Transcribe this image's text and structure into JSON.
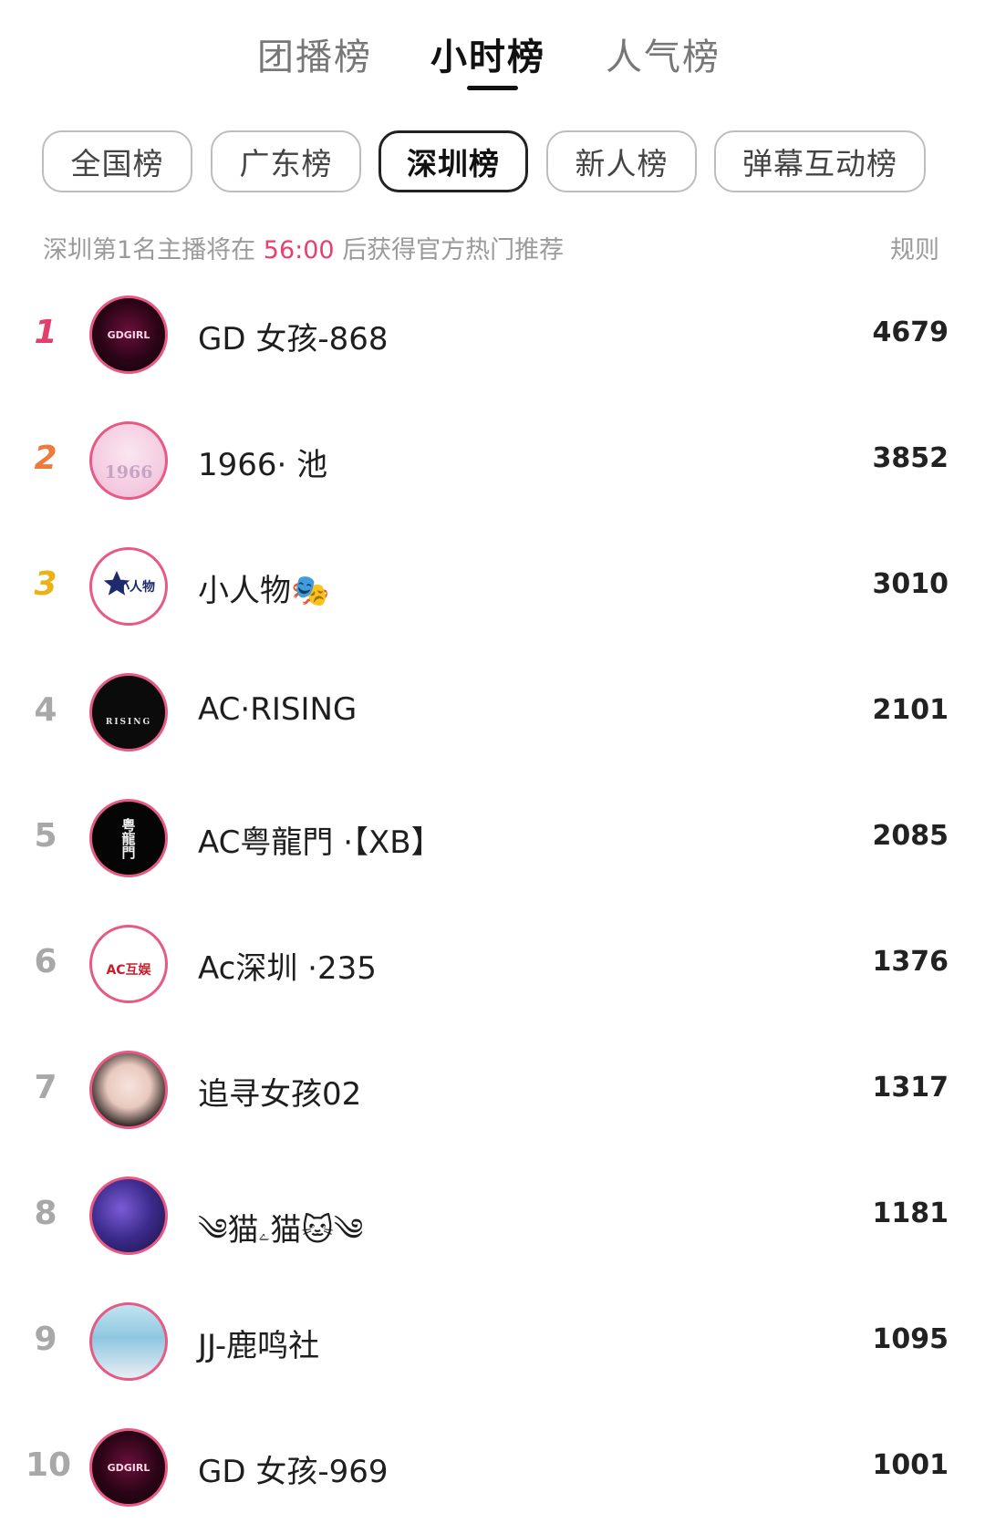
{
  "top_tabs": [
    {
      "label": "团播榜"
    },
    {
      "label": "小时榜"
    },
    {
      "label": "人气榜"
    }
  ],
  "active_top_tab": "小时榜",
  "filters": [
    {
      "label": "全国榜"
    },
    {
      "label": "广东榜"
    },
    {
      "label": "深圳榜"
    },
    {
      "label": "新人榜"
    },
    {
      "label": "弹幕互动榜"
    }
  ],
  "active_filter": "深圳榜",
  "notice": {
    "prefix": "深圳第1名主播将在",
    "countdown": "56:00",
    "suffix": "后获得官方热门推荐"
  },
  "rules_label": "规则",
  "colors": {
    "accent_pink": "#e8406e",
    "rank1": "#e2406b",
    "rank2": "#ee7a3d",
    "rank3": "#eab216"
  },
  "entries": [
    {
      "rank": "1",
      "name": "GD 女孩-868",
      "score": "4679",
      "avatar_text": "GDGIRL"
    },
    {
      "rank": "2",
      "name": "1966· 池",
      "score": "3852",
      "avatar_text": "1966"
    },
    {
      "rank": "3",
      "name": "小人物🎭",
      "score": "3010",
      "avatar_text": "小人物"
    },
    {
      "rank": "4",
      "name": "AC·RISING",
      "score": "2101",
      "avatar_text": "RISING"
    },
    {
      "rank": "5",
      "name": "AC粤龍門 ·【XB】",
      "score": "2085",
      "avatar_text": "粤龍門"
    },
    {
      "rank": "6",
      "name": "Ac深圳 ·235",
      "score": "1376",
      "avatar_text": "AC互娱"
    },
    {
      "rank": "7",
      "name": "追寻女孩02",
      "score": "1317",
      "avatar_text": ""
    },
    {
      "rank": "8",
      "name": "༄猫ۦ猫🐱༄",
      "score": "1181",
      "avatar_text": ""
    },
    {
      "rank": "9",
      "name": "JJ-鹿鸣社",
      "score": "1095",
      "avatar_text": ""
    },
    {
      "rank": "10",
      "name": "GD 女孩-969",
      "score": "1001",
      "avatar_text": "GDGIRL"
    }
  ]
}
